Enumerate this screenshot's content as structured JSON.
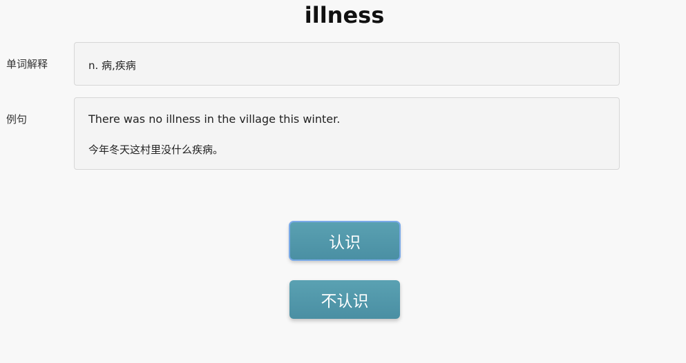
{
  "word": "illness",
  "definition": {
    "label": "单词解释",
    "text": "n. 病,疾病"
  },
  "example": {
    "label": "例句",
    "sentence_en": "There was no illness in the village this winter.",
    "sentence_zh": "今年冬天这村里没什么疾病。"
  },
  "buttons": {
    "know_label": "认识",
    "unknown_label": "不认识"
  }
}
